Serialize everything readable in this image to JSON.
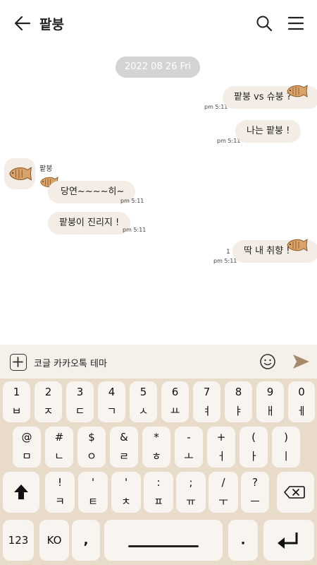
{
  "header": {
    "title": "팥붕"
  },
  "chat": {
    "date": "2022 08 26 Fri",
    "sender_name": "팥붕",
    "messages": [
      {
        "side": "right",
        "text": "팥붕 vs 슈붕 ?",
        "time": "pm 5:11",
        "read_count": ""
      },
      {
        "side": "right",
        "text": "나는 팥붕 !",
        "time": "pm 5:11",
        "read_count": ""
      },
      {
        "side": "left",
        "text": "당연~~~~히~",
        "time": "pm 5:11"
      },
      {
        "side": "left",
        "text": "팥붕이 진리지 !",
        "time": "pm 5:11"
      },
      {
        "side": "right",
        "text": "딱 내 취향 !",
        "time": "pm 5:11",
        "read_count": "1"
      }
    ]
  },
  "input": {
    "text": "코글 카카오톡 테마"
  },
  "keyboard": {
    "row1": [
      {
        "top": "1",
        "bot": "ㅂ"
      },
      {
        "top": "2",
        "bot": "ㅈ"
      },
      {
        "top": "3",
        "bot": "ㄷ"
      },
      {
        "top": "4",
        "bot": "ㄱ"
      },
      {
        "top": "5",
        "bot": "ㅅ"
      },
      {
        "top": "6",
        "bot": "ㅛ"
      },
      {
        "top": "7",
        "bot": "ㅕ"
      },
      {
        "top": "8",
        "bot": "ㅑ"
      },
      {
        "top": "9",
        "bot": "ㅐ"
      },
      {
        "top": "0",
        "bot": "ㅔ"
      }
    ],
    "row2": [
      {
        "top": "@",
        "bot": "ㅁ"
      },
      {
        "top": "#",
        "bot": "ㄴ"
      },
      {
        "top": "$",
        "bot": "ㅇ"
      },
      {
        "top": "&",
        "bot": "ㄹ"
      },
      {
        "top": "*",
        "bot": "ㅎ"
      },
      {
        "top": "-",
        "bot": "ㅗ"
      },
      {
        "top": "+",
        "bot": "ㅓ"
      },
      {
        "top": "(",
        "bot": "ㅏ"
      },
      {
        "top": ")",
        "bot": "ㅣ"
      }
    ],
    "row3": [
      {
        "top": "!",
        "bot": "ㅋ"
      },
      {
        "top": "'",
        "bot": "ㅌ"
      },
      {
        "top": "'",
        "bot": "ㅊ"
      },
      {
        "top": ":",
        "bot": "ㅍ"
      },
      {
        "top": ";",
        "bot": "ㅠ"
      },
      {
        "top": "/",
        "bot": "ㅜ"
      },
      {
        "top": "?",
        "bot": "ㅡ"
      }
    ],
    "num_key": "123",
    "lang_key": "KO",
    "comma_key": ",",
    "period_key": "."
  },
  "colors": {
    "bubble": "#f3ede6",
    "keyboard_bg": "#e8dbc9",
    "key": "#f8f4ef",
    "send": "#a88a6a",
    "fish": "#d9a36a"
  },
  "icons": [
    "back-arrow-icon",
    "search-icon",
    "menu-icon",
    "plus-icon",
    "emoji-icon",
    "send-icon",
    "shift-icon",
    "backspace-icon",
    "enter-icon",
    "taiyaki-icon"
  ]
}
